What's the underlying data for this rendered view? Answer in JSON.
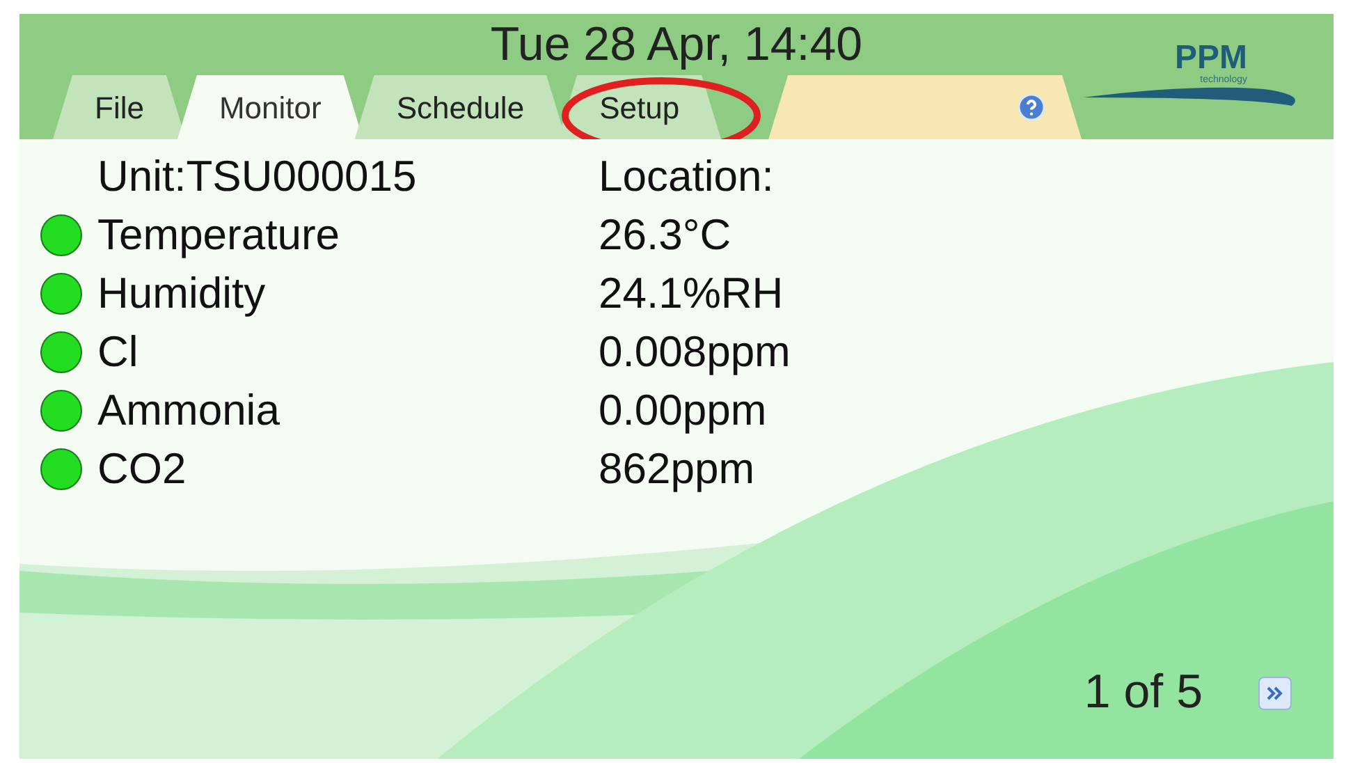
{
  "header": {
    "datetime": "Tue 28 Apr, 14:40",
    "logo": {
      "title": "PPM",
      "subtitle": "technology"
    }
  },
  "tabs": [
    {
      "label": "File",
      "selected": false
    },
    {
      "label": "Monitor",
      "selected": true
    },
    {
      "label": "Schedule",
      "selected": false
    },
    {
      "label": "Setup",
      "selected": false
    }
  ],
  "unit": {
    "label": "Unit:TSU000015",
    "location": "Location:"
  },
  "readings": [
    {
      "name": "Temperature",
      "value": "26.3°C",
      "color": "#22dd22"
    },
    {
      "name": "Humidity",
      "value": "24.1%RH",
      "color": "#22dd22"
    },
    {
      "name": "Cl",
      "value": "0.008ppm",
      "color": "#22dd22"
    },
    {
      "name": "Ammonia",
      "value": "0.00ppm",
      "color": "#22dd22"
    },
    {
      "name": "CO2",
      "value": "862ppm",
      "color": "#22dd22"
    }
  ],
  "pager": {
    "text": "1 of 5"
  }
}
